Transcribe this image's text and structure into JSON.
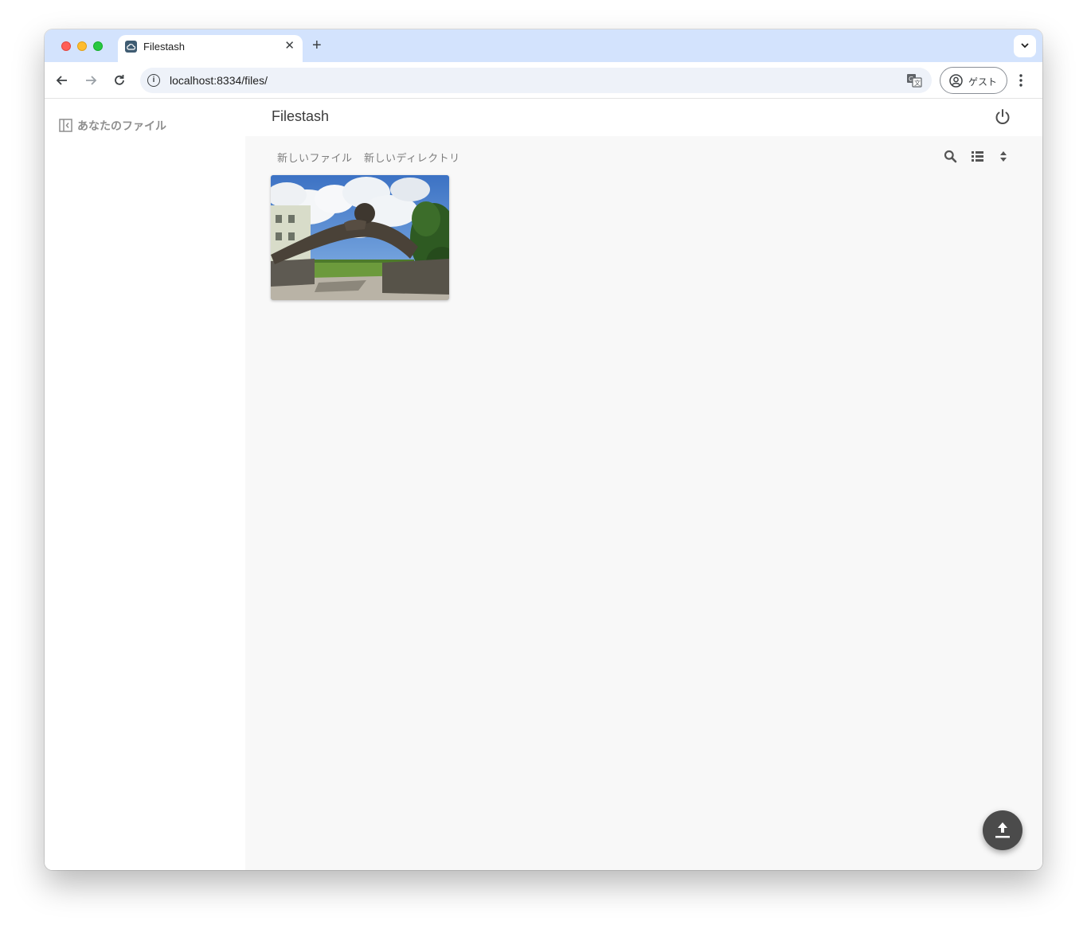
{
  "browser": {
    "tab": {
      "title": "Filestash"
    },
    "address_bar": {
      "url": "localhost:8334/files/"
    },
    "profile": {
      "label": "ゲスト"
    }
  },
  "sidebar": {
    "title": "あなたのファイル"
  },
  "app": {
    "brand": "Filestash",
    "actions": {
      "new_file": "新しいファイル",
      "new_directory": "新しいディレクトリ"
    },
    "files": [
      {
        "type": "image",
        "thumbnail": "photo of stone arch gate under blue sky"
      }
    ]
  },
  "colors": {
    "tabstrip": "#d3e3fd",
    "main_background": "#f8f8f8",
    "fab": "#4b4b4b"
  }
}
